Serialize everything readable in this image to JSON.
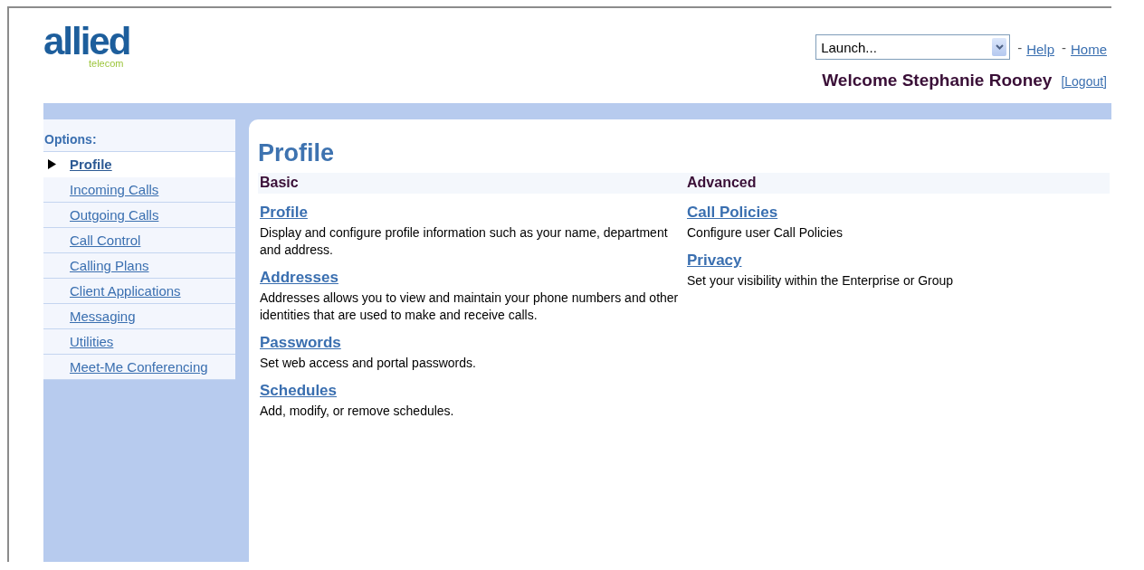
{
  "logo": {
    "name": "allied",
    "tagline": "telecom"
  },
  "header": {
    "launch": {
      "value": "Launch..."
    },
    "links": [
      {
        "separator": "-",
        "label": "Help"
      },
      {
        "separator": "-",
        "label": "Home"
      }
    ],
    "welcome": "Welcome Stephanie Rooney",
    "logout": "[Logout]"
  },
  "sidebar": {
    "title": "Options:",
    "items": [
      {
        "label": "Profile",
        "selected": true
      },
      {
        "label": "Incoming Calls",
        "selected": false
      },
      {
        "label": "Outgoing Calls",
        "selected": false
      },
      {
        "label": "Call Control",
        "selected": false
      },
      {
        "label": "Calling Plans",
        "selected": false
      },
      {
        "label": "Client Applications",
        "selected": false
      },
      {
        "label": "Messaging",
        "selected": false
      },
      {
        "label": "Utilities",
        "selected": false
      },
      {
        "label": "Meet-Me Conferencing",
        "selected": false
      }
    ]
  },
  "page_title": "Profile",
  "sections": [
    {
      "heading": "Basic",
      "entries": [
        {
          "link": "Profile",
          "description": "Display and configure profile information such as your name, department and address."
        },
        {
          "link": "Addresses",
          "description": "Addresses allows you to view and maintain your phone numbers and other identities that are used to make and receive calls."
        },
        {
          "link": "Passwords",
          "description": "Set web access and portal passwords."
        },
        {
          "link": "Schedules",
          "description": "Add, modify, or remove schedules."
        }
      ]
    },
    {
      "heading": "Advanced",
      "entries": [
        {
          "link": "Call Policies",
          "description": "Configure user Call Policies"
        },
        {
          "link": "Privacy",
          "description": "Set your visibility within the Enterprise or Group"
        }
      ]
    }
  ]
}
